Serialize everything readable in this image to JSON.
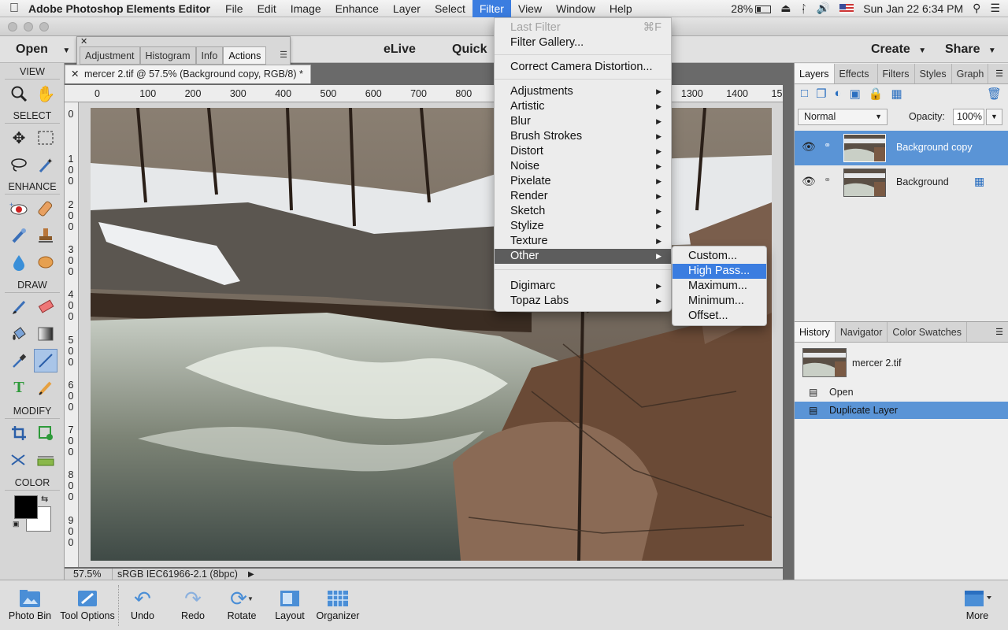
{
  "menubar": {
    "app_name": "Adobe Photoshop Elements Editor",
    "items": [
      "File",
      "Edit",
      "Image",
      "Enhance",
      "Layer",
      "Select",
      "Filter",
      "View",
      "Window",
      "Help"
    ],
    "active_item": "Filter",
    "battery": "28%",
    "datetime": "Sun Jan 22  6:34 PM"
  },
  "topbar": {
    "open_label": "Open",
    "elive_label": "eLive",
    "quick_label": "Quick",
    "create_label": "Create",
    "share_label": "Share"
  },
  "floating_panel": {
    "tabs": [
      "Adjustment",
      "Histogram",
      "Info",
      "Actions"
    ],
    "active_tab": "Actions"
  },
  "toolbox": {
    "sections": {
      "view": "VIEW",
      "select": "SELECT",
      "enhance": "ENHANCE",
      "draw": "DRAW",
      "modify": "MODIFY",
      "color": "COLOR"
    },
    "selected_tool": "line-tool"
  },
  "document": {
    "tab_title": "mercer 2.tif @ 57.5% (Background copy, RGB/8) *",
    "zoom": "57.5%",
    "profile": "sRGB IEC61966-2.1 (8bpc)"
  },
  "ruler": {
    "h_ticks": [
      "0",
      "100",
      "200",
      "300",
      "400",
      "500",
      "600",
      "700",
      "800",
      "900",
      "1000",
      "1100",
      "1200",
      "1300",
      "1400",
      "15"
    ],
    "v_ticks": [
      "0",
      "1\n0\n0",
      "2\n0\n0",
      "3\n0\n0",
      "4\n0\n0",
      "5\n0\n0",
      "6\n0\n0",
      "7\n0\n0",
      "8\n0\n0",
      "9\n0\n0"
    ]
  },
  "filter_menu": {
    "items": [
      {
        "label": "Last Filter",
        "shortcut": "⌘F",
        "disabled": true
      },
      {
        "label": "Filter Gallery..."
      },
      {
        "label": "Correct Camera Distortion..."
      },
      {
        "label": "Adjustments",
        "submenu": true
      },
      {
        "label": "Artistic",
        "submenu": true
      },
      {
        "label": "Blur",
        "submenu": true
      },
      {
        "label": "Brush Strokes",
        "submenu": true
      },
      {
        "label": "Distort",
        "submenu": true
      },
      {
        "label": "Noise",
        "submenu": true
      },
      {
        "label": "Pixelate",
        "submenu": true
      },
      {
        "label": "Render",
        "submenu": true
      },
      {
        "label": "Sketch",
        "submenu": true
      },
      {
        "label": "Stylize",
        "submenu": true
      },
      {
        "label": "Texture",
        "submenu": true
      },
      {
        "label": "Other",
        "submenu": true,
        "highlighted": true
      },
      {
        "label": "Digimarc",
        "submenu": true
      },
      {
        "label": "Topaz Labs",
        "submenu": true
      }
    ]
  },
  "other_submenu": {
    "items": [
      "Custom...",
      "High Pass...",
      "Maximum...",
      "Minimum...",
      "Offset..."
    ],
    "highlighted": "High Pass..."
  },
  "layers_panel": {
    "tabs": [
      "Layers",
      "Effects",
      "Filters",
      "Styles",
      "Graph"
    ],
    "active_tab": "Layers",
    "blend_mode": "Normal",
    "opacity_label": "Opacity:",
    "opacity_value": "100%",
    "layers": [
      {
        "name": "Background copy",
        "selected": true
      },
      {
        "name": "Background",
        "selected": false
      }
    ]
  },
  "history_panel": {
    "tabs": [
      "History",
      "Navigator",
      "Color Swatches"
    ],
    "active_tab": "History",
    "snapshot": "mercer 2.tif",
    "steps": [
      {
        "label": "Open",
        "selected": false
      },
      {
        "label": "Duplicate Layer",
        "selected": true
      }
    ]
  },
  "bottombar": {
    "buttons": [
      "Photo Bin",
      "Tool Options",
      "Undo",
      "Redo",
      "Rotate",
      "Layout",
      "Organizer"
    ],
    "more_label": "More"
  },
  "colors": {
    "accent": "#3b7de0",
    "selection": "#5a94d6",
    "menu_highlight": "#5d5d5d"
  }
}
